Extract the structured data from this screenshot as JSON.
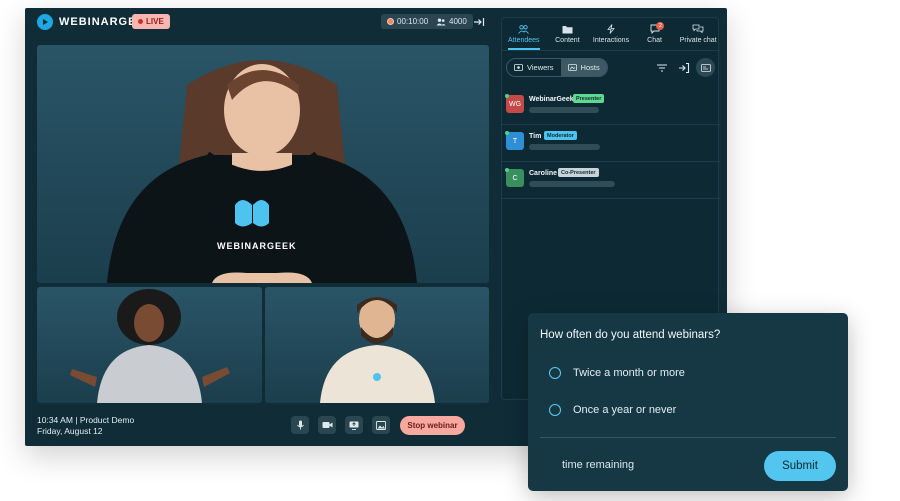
{
  "brand": {
    "name": "WEBINARGEEK",
    "accent": "#4fc3f0"
  },
  "header": {
    "live_label": "LIVE",
    "timer": "00:10:00",
    "viewer_count": "4000"
  },
  "meeting": {
    "time_title": "10:34 AM | Product Demo",
    "date": "Friday, August 12"
  },
  "controls": {
    "icons": [
      "microphone-icon",
      "camera-icon",
      "screen-share-icon",
      "image-icon"
    ],
    "stop_label": "Stop webinar"
  },
  "sidebar": {
    "tabs": [
      {
        "label": "Attendees",
        "icon": "users-icon"
      },
      {
        "label": "Content",
        "icon": "folder-icon"
      },
      {
        "label": "Interactions",
        "icon": "lightning-icon"
      },
      {
        "label": "Chat",
        "icon": "chat-icon",
        "badge": "2"
      },
      {
        "label": "Private chat",
        "icon": "private-chat-icon"
      }
    ],
    "active_tab": "Attendees",
    "segment": {
      "viewers": "Viewers",
      "hosts": "Hosts"
    },
    "attendees": [
      {
        "initials": "WG",
        "name": "WebinarGeek",
        "role": "Presenter",
        "avatar_color": "#c44a4a",
        "role_color": "#5fd98f"
      },
      {
        "initials": "T",
        "name": "Tim",
        "role": "Moderator",
        "avatar_color": "#2f8fd6",
        "role_color": "#4fc3f0"
      },
      {
        "initials": "C",
        "name": "Caroline",
        "role": "Co-Presenter",
        "avatar_color": "#3a8f5f",
        "role_color": "#c8d3d7"
      }
    ]
  },
  "poll": {
    "question": "How often do you attend webinars?",
    "options": [
      "Twice a month or more",
      "Once a year or never"
    ],
    "time_remaining_label": "time remaining",
    "submit_label": "Submit"
  }
}
